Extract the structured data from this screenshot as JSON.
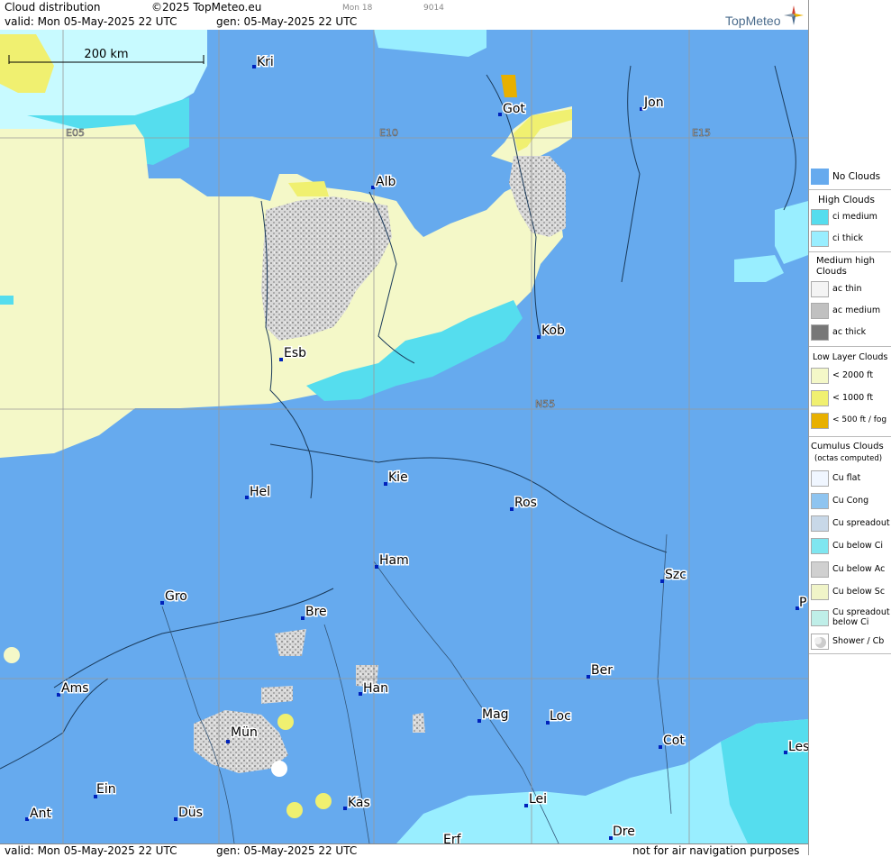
{
  "header": {
    "title": "Cloud distribution",
    "copyright": "©2025 TopMeteo.eu",
    "valid": "valid:  Mon  05-May-2025  22 UTC",
    "gen": "gen: 05-May-2025 22 UTC",
    "tiny_day": "Mon 18",
    "tiny_code": "9014",
    "logo": "TopMeteo"
  },
  "footer": {
    "valid": "valid:  Mon  05-May-2025  22 UTC",
    "gen": "gen: 05-May-2025 22 UTC",
    "disclaimer": "not for air navigation purposes"
  },
  "map": {
    "scale_label": "200 km",
    "grid_labels": [
      "E05",
      "E10",
      "E15",
      "N55"
    ],
    "cities": [
      "Kri",
      "Got",
      "Jon",
      "Alb",
      "Esb",
      "Kob",
      "Kie",
      "Hel",
      "Ros",
      "Ham",
      "Szc",
      "Gro",
      "Bre",
      "P",
      "Ams",
      "Han",
      "Ber",
      "Mün",
      "Mag",
      "Loc",
      "Cot",
      "Les",
      "Ein",
      "Kas",
      "Lei",
      "Ant",
      "Düs",
      "Dre",
      "Erf"
    ]
  },
  "colors": {
    "no_clouds": "#66aaee",
    "ci_medium": "#55ddee",
    "ci_thick": "#99eeff",
    "low_2000": "#f4f8c8",
    "low_1000": "#f0f070",
    "low_500": "#e8b000",
    "ac_medium": "#c0c0c0"
  },
  "legend": {
    "no_clouds": "No Clouds",
    "high_title": "High Clouds",
    "ci_medium": "ci medium",
    "ci_thick": "ci thick",
    "medium_title_1": "Medium high",
    "medium_title_2": "Clouds",
    "ac_thin": "ac thin",
    "ac_medium": "ac medium",
    "ac_thick": "ac thick",
    "low_title": "Low Layer Clouds",
    "low_2000": "< 2000 ft",
    "low_1000": "< 1000 ft",
    "low_500": "< 500 ft / fog",
    "cu_title": "Cumulus Clouds",
    "cu_sub": "(octas computed)",
    "cu_flat": "Cu flat",
    "cu_cong": "Cu Cong",
    "cu_spread": "Cu spreadout",
    "cu_below_ci": "Cu below Ci",
    "cu_below_ac": "Cu below Ac",
    "cu_below_sc": "Cu below Sc",
    "cu_spread_ci_1": "Cu spreadout",
    "cu_spread_ci_2": "below Ci",
    "shower": "Shower / Cb"
  }
}
